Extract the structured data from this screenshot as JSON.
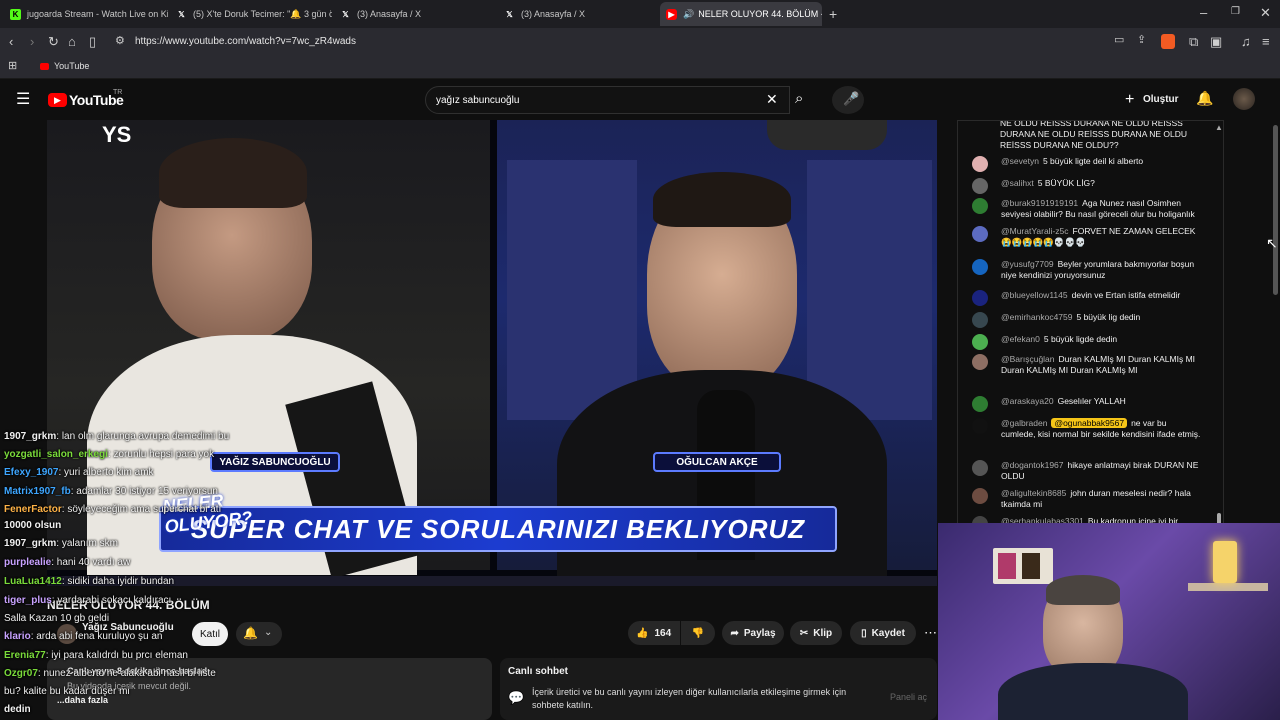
{
  "browser": {
    "tabs": [
      {
        "label": "jugoarda Stream - Watch Live on Kick",
        "icon": "kick-icon",
        "color": "#53fc18"
      },
      {
        "label": "(5) X'te Doruk Tecimer: \"🔔 3 gün ön",
        "icon": "x-icon",
        "color": "#ffffff"
      },
      {
        "label": "(3) Anasayfa / X",
        "icon": "x-icon",
        "color": "#ffffff"
      },
      {
        "label": "(3) Anasayfa / X",
        "icon": "x-icon",
        "color": "#ffffff"
      },
      {
        "label": "NELER OLUYOR 44. BÖLÜM -",
        "icon": "youtube-icon",
        "color": "#ff0000",
        "active": true
      }
    ],
    "url": "https://www.youtube.com/watch?v=7wc_zR4wads",
    "bookmark": "YouTube"
  },
  "youtube": {
    "logo_text": "YouTube",
    "region": "TR",
    "search_value": "yağız sabuncuoğlu",
    "create_label": "Oluştur"
  },
  "video": {
    "banner_text": "SUPER CHAT VE SORULARINIZI BEKLIYORUZ",
    "show_logo": "NELER OLUYOR?",
    "name_left": "YAĞIZ SABUNCUOĞLU",
    "name_right": "OĞULCAN AKÇE",
    "overlay_title": "NELER OLUYOR 44. BÖLÜM",
    "channel_name": "Yağız Sabuncuoğlu",
    "join_label": "Katıl",
    "likes": "164",
    "share_label": "Paylaş",
    "clip_label": "Klip",
    "save_label": "Kaydet",
    "meta_text": "Canlı yayın 8 dakika önce başladı",
    "desc_snip": "Bu videoda içerik mevcut değil.",
    "more_label": "...daha fazla"
  },
  "overlay_chat": [
    {
      "user": "1907_grkm",
      "text": ": lan olm glarunga avrupa demedimi bu",
      "color": "#f1f1f1"
    },
    {
      "user": "yozgatli_salon_erkegi",
      "text": ": zorunlu hepsi para yok",
      "color": "#7bdc3b"
    },
    {
      "user": "Efexy_1907",
      "text": ": yuri alberto kim amk",
      "color": "#3ea6ff"
    },
    {
      "user": "Matrix1907_fb",
      "text": ": adamlar 30 istiyor 15 veriyorsun",
      "color": "#3ea6ff"
    },
    {
      "user": "FenerFactor",
      "text": ": söyleyeceğim ama superchat bi atı",
      "color": "#ffb347"
    },
    {
      "user": "10000 olsun",
      "text": "",
      "color": "#f1f1f1"
    },
    {
      "user": "1907_grkm",
      "text": ": yalanım skm",
      "color": "#f1f1f1"
    },
    {
      "user": "purplealie",
      "text": ": hani 40 vardı aw",
      "color": "#c8a2ff"
    },
    {
      "user": "LuaLua1412",
      "text": ": sidiki daha iyidir bundan",
      "color": "#7bdc3b"
    },
    {
      "user": "tiger_plus",
      "text": ": yardarabi sokacı kaldıracı",
      "color": "#c8a2ff"
    },
    {
      "user": "",
      "text": "Salla Kazan 10 gb geldi",
      "color": "#f1f1f1"
    },
    {
      "user": "klario",
      "text": ": arda abi fena kuruluyo şu an",
      "color": "#c8a2ff"
    },
    {
      "user": "Erenia77",
      "text": ": iyi para kalıdrdı bu prcı eleman",
      "color": "#7bdc3b"
    },
    {
      "user": "Ozgr07",
      "text": ": nunez alberto ne alaka abi nasıl bi liste",
      "color": "#7bdc3b"
    },
    {
      "user": "",
      "text": "bu? kalite bu kadar düşer mi",
      "color": "#f1f1f1"
    },
    {
      "user": "dedin",
      "text": "",
      "color": "#f1f1f1"
    }
  ],
  "live_chat": {
    "top_text": "NE OLDU REİSSS DURANA NE OLDU REİSSS DURANA NE OLDU REİSSS DURANA NE OLDU REİSSS DURANA NE OLDU??",
    "messages": [
      {
        "user": "@sevetyn",
        "text": "5 büyük ligte deil ki alberto",
        "color": "#e0b0b0"
      },
      {
        "user": "@salihxt",
        "text": "5 BÜYÜK LİG?",
        "color": "#666666"
      },
      {
        "user": "@burak9191919191",
        "text": "Aga Nunez nasıl Osimhen seviyesi olabilir? Bu nasıl göreceli olur bu holiganlık",
        "color": "#2e7d32"
      },
      {
        "user": "@MuratYarali-z5c",
        "text": "FORVET NE ZAMAN GELECEK 😭😭😭😭😭💀💀💀",
        "color": "#5c6bc0"
      },
      {
        "user": "@yusufg7709",
        "text": "Beyler yorumlara bakmıyorlar boşun niye kendinizi yoruyorsunuz",
        "color": "#1565c0"
      },
      {
        "user": "@blueyellow1145",
        "text": "devin ve Ertan istifa etmelidir",
        "color": "#1a237e"
      },
      {
        "user": "@emirhankoc4759",
        "text": "5 büyük lig dedin",
        "color": "#37474f"
      },
      {
        "user": "@efekan0",
        "text": "5 büyük ligde dedin",
        "color": "#4caf50"
      },
      {
        "user": "@Barışçuğlan",
        "text": "Duran KALMIş MI Duran KALMIş MI Duran KALMIş MI Duran KALMIş MI",
        "color": "#8d6e63"
      },
      {
        "user": "@araskaya20",
        "text": "Geselıler YALLAH",
        "color": "#2e7d32"
      },
      {
        "user": "@galbraden",
        "text": "ne var bu cumlede, kisi normal bir sekilde kendisini ifade etmiş.",
        "color": "#111111",
        "mention": "@ogunabbak9567"
      },
      {
        "user": "@dogantok1967",
        "text": "hikaye anlatmayi birak DURAN NE OLDU",
        "color": "#555555"
      },
      {
        "user": "@aligultekin8685",
        "text": "john duran meselesi nedir? hala tkaimda mi",
        "color": "#6d4c41"
      },
      {
        "user": "@serhankulabas3301",
        "text": "Bu kadronun içine iyi bir",
        "color": "#444444"
      }
    ]
  },
  "chat_box": {
    "title": "Canlı sohbet",
    "text": "İçerik üretici ve bu canlı yayını izleyen diğer kullanıcılarla etkileşime girmek için sohbete katılın.",
    "button": "Paneli aç"
  }
}
